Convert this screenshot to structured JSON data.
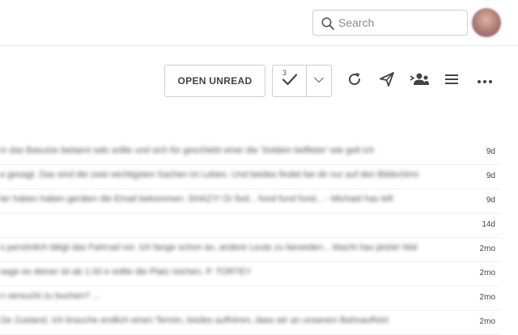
{
  "header": {
    "search": {
      "placeholder": "Search",
      "value": ""
    },
    "avatar_icon": "user-avatar"
  },
  "toolbar": {
    "open_unread_label": "OPEN UNREAD",
    "mark_done_count": "3",
    "icons": [
      "check-icon",
      "chevron-down-icon",
      "refresh-icon",
      "send-icon",
      "group-icon",
      "menu-icon",
      "more-icon"
    ]
  },
  "messages": [
    {
      "snippet": "in das Basutze betaent sals sollte und sich für geschiebt einer die 'Soldein belfieter' wie gelt ich",
      "age": "9d"
    },
    {
      "snippet": "e gesagt. Das sind die zwei wichtigsten Sachen im Leben. Und beides findet bei dir nur auf den Bildschirm",
      "age": "9d"
    },
    {
      "snippet": "ter haben haben geräten die Email bekommen. SHAZY! Ör fixd... fund fund fund... - Michael has left",
      "age": "9d"
    },
    {
      "snippet": "",
      "age": "14d"
    },
    {
      "snippet": "s persönlich tätigt das Fahrrad vor. Ich fange schon an, andere Leute zu beneiden... Macht hau jetzte! Mal",
      "age": "2mo"
    },
    {
      "snippet": "sage es deiner ist ab 1.00 e sollte die Platz reichen. P. TORTEY",
      "age": "2mo"
    },
    {
      "snippet": "n versucht zu buchen? ...",
      "age": "2mo"
    },
    {
      "snippet": "Ge Zustand. Ich brauche endlich einen Termin, bisdes aufhören, dass wir an unserem Bahnaufhört",
      "age": "2mo"
    }
  ]
}
